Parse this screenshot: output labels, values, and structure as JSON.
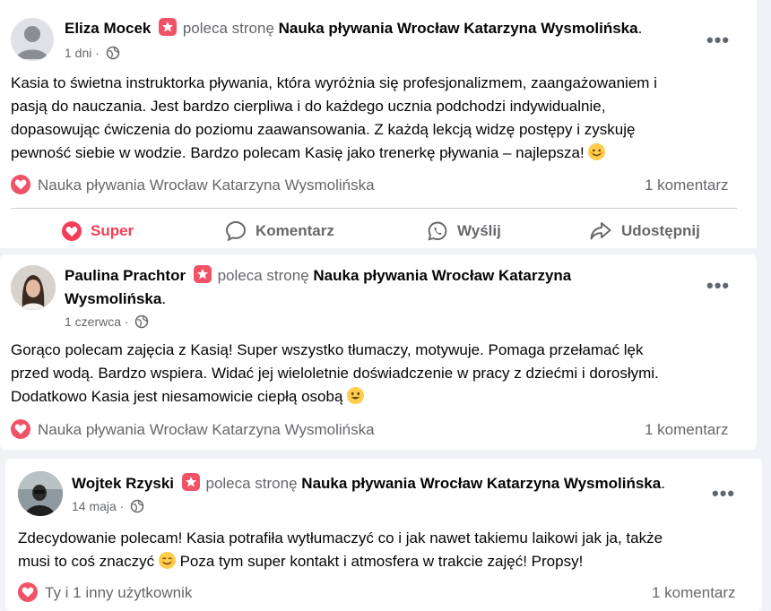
{
  "posts": [
    {
      "author": "Eliza Mocek",
      "recommends": "poleca stronę",
      "page": "Nauka pływania Wrocław Katarzyna Wysmolińska",
      "page_line2": "",
      "time": "1 dni",
      "more": "•••",
      "text_lines": [
        "Kasia to świetna instruktorka pływania, która wyróżnia się profesjonalizmem, zaangażowaniem i",
        "pasją do nauczania. Jest bardzo cierpliwa i do każdego ucznia podchodzi indywidualnie,",
        "dopasowując ćwiczenia do poziomu zaawansowania. Z każdą lekcją widzę postępy i zyskuję",
        "pewność siebie w wodzie. Bardzo polecam Kasię jako trenerkę pływania – najlepsza!"
      ],
      "reactions": "Nauka pływania Wrocław Katarzyna Wysmolińska",
      "comments": "1 komentarz",
      "actions": {
        "like": "Super",
        "comment": "Komentarz",
        "send": "Wyślij",
        "share": "Udostępnij"
      }
    },
    {
      "author": "Paulina Prachtor",
      "recommends": "poleca stronę",
      "page": "Nauka pływania Wrocław Katarzyna",
      "page_line2": "Wysmolińska",
      "time": "1 czerwca",
      "more": "•••",
      "text_lines": [
        "Gorąco polecam zajęcia z Kasią! Super wszystko tłumaczy, motywuje. Pomaga przełamać lęk",
        "przed wodą. Bardzo wspiera. Widać jej wieloletnie doświadczenie w pracy z dziećmi i dorosłymi.",
        "Dodatkowo Kasia jest niesamowicie ciepłą osobą"
      ],
      "reactions": "Nauka pływania Wrocław Katarzyna Wysmolińska",
      "comments": "1 komentarz"
    },
    {
      "author": "Wojtek Rzyski",
      "recommends": "poleca stronę",
      "page": "Nauka pływania Wrocław Katarzyna Wysmolińska",
      "time": "14 maja",
      "more": "•••",
      "text_lines": [
        "Zdecydowanie polecam! Kasia potrafiła wytłumaczyć co i jak nawet takiemu laikowi jak ja, także",
        "musi to coś znaczyć",
        "Poza tym super kontakt i atmosfera w trakcie zajęć! Propsy!"
      ],
      "reactions": "Ty i 1 inny użytkownik",
      "comments": "1 komentarz"
    }
  ],
  "colors": {
    "accent": "#f33e58",
    "muted": "#65676b",
    "badge": "#f25268"
  }
}
